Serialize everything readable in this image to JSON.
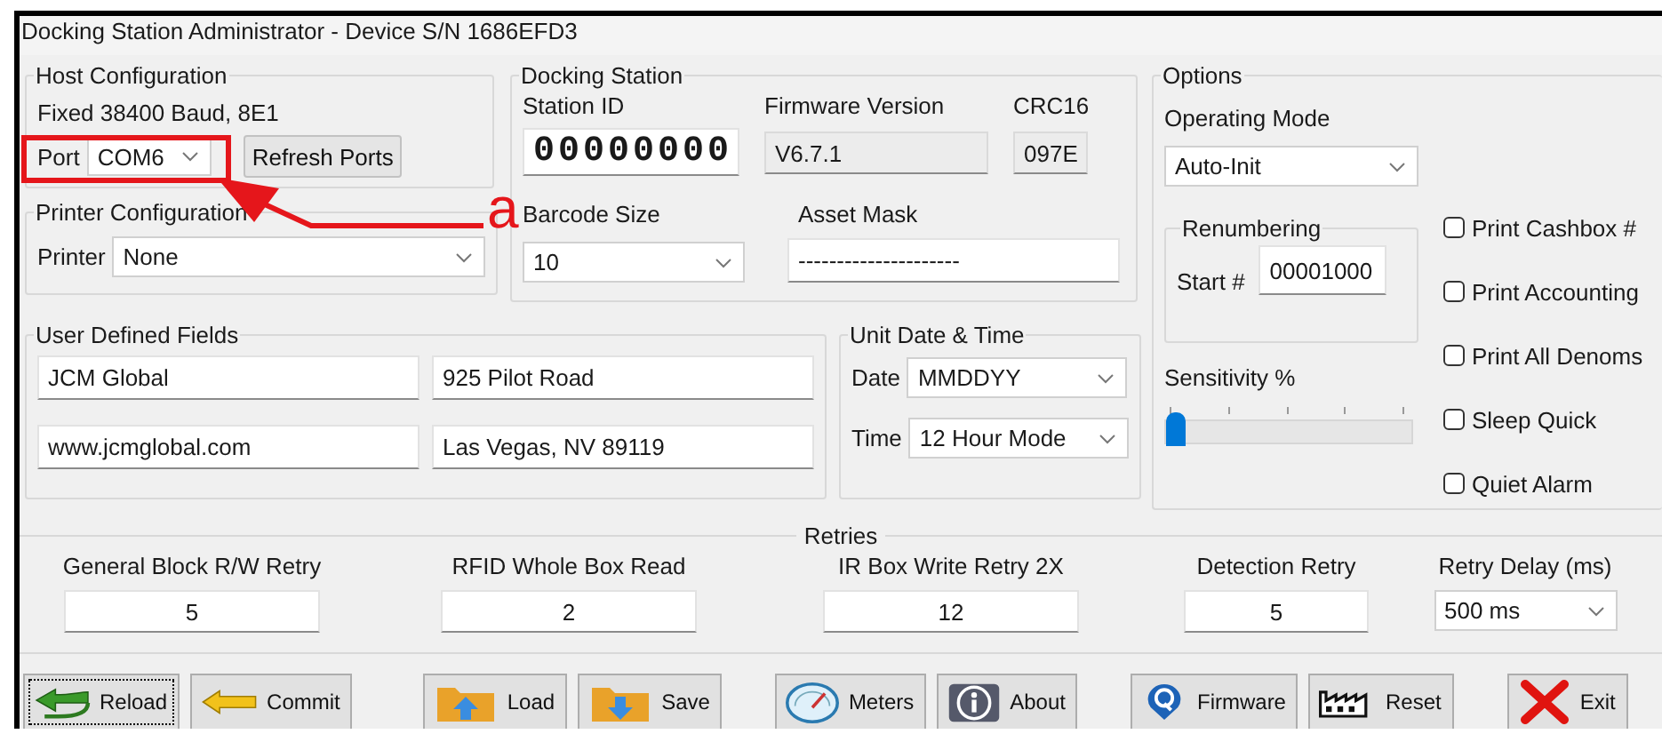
{
  "window": {
    "title": "Docking Station Administrator - Device S/N 1686EFD3"
  },
  "host_configuration": {
    "title": "Host Configuration",
    "baud": "Fixed 38400 Baud, 8E1",
    "port_label": "Port",
    "port": "COM6",
    "refresh_button": "Refresh Ports"
  },
  "printer_configuration": {
    "title": "Printer Configuration",
    "printer_label": "Printer",
    "printer": "None"
  },
  "docking_station": {
    "title": "Docking Station",
    "station_id_label": "Station ID",
    "station_id": "00000000",
    "firmware_label": "Firmware Version",
    "firmware": "V6.7.1",
    "crc_label": "CRC16",
    "crc": "097E",
    "barcode_label": "Barcode Size",
    "barcode": "10",
    "asset_mask_label": "Asset Mask",
    "asset_mask": "---------------------"
  },
  "options": {
    "title": "Options",
    "operating_mode_label": "Operating Mode",
    "operating_mode": "Auto-Init",
    "renumbering": {
      "title": "Renumbering",
      "start_label": "Start #",
      "start": "00001000"
    },
    "sensitivity": {
      "label": "Sensitivity %",
      "level": 0
    },
    "checkboxes": [
      {
        "label": "Print Cashbox #",
        "checked": false
      },
      {
        "label": "Print Accounting",
        "checked": false
      },
      {
        "label": "Print All Denoms",
        "checked": false
      },
      {
        "label": "Sleep Quick",
        "checked": false
      },
      {
        "label": "Quiet Alarm",
        "checked": false
      }
    ]
  },
  "user_defined_fields": {
    "title": "User Defined Fields",
    "fields": [
      "JCM Global",
      "925 Pilot Road",
      "www.jcmglobal.com",
      "Las Vegas, NV 89119"
    ]
  },
  "unit_date_time": {
    "title": "Unit Date & Time",
    "date_label": "Date",
    "date": "MMDDYY",
    "time_label": "Time",
    "time": "12 Hour Mode"
  },
  "retries": {
    "title": "Retries",
    "fields": [
      {
        "label": "General Block R/W Retry",
        "value": "5",
        "kind": "input"
      },
      {
        "label": "RFID Whole Box Read",
        "value": "2",
        "kind": "input"
      },
      {
        "label": "IR Box Write Retry 2X",
        "value": "12",
        "kind": "input"
      },
      {
        "label": "Detection Retry",
        "value": "5",
        "kind": "input"
      },
      {
        "label": "Retry Delay (ms)",
        "value": "500 ms",
        "kind": "dropdown"
      }
    ]
  },
  "toolbar_groups": [
    {
      "buttons": [
        {
          "label": "Reload",
          "focused": true
        },
        {
          "label": "Commit",
          "focused": false
        }
      ]
    },
    {
      "buttons": [
        {
          "label": "Load",
          "focused": false
        },
        {
          "label": "Save",
          "focused": false
        }
      ]
    },
    {
      "buttons": [
        {
          "label": "Meters",
          "focused": false
        },
        {
          "label": "About",
          "focused": false
        }
      ]
    },
    {
      "buttons": [
        {
          "label": "Firmware",
          "focused": false
        },
        {
          "label": "Reset",
          "focused": false
        }
      ]
    },
    {
      "buttons": [
        {
          "label": "Exit",
          "focused": false
        }
      ]
    }
  ],
  "annotation": {
    "label": "a"
  }
}
